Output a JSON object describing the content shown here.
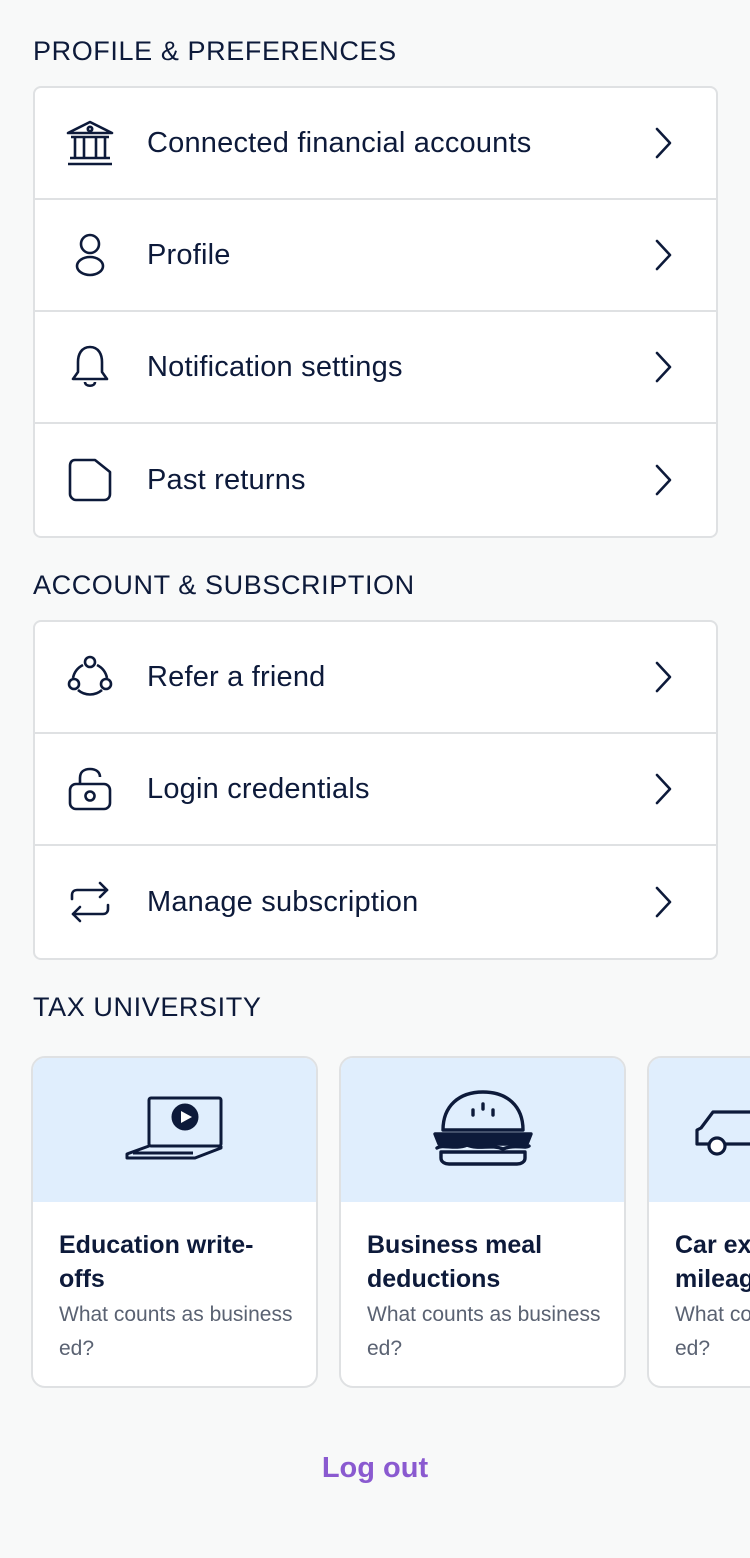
{
  "profile_section": {
    "title": "PROFILE & PREFERENCES",
    "items": [
      {
        "label": "Connected financial accounts",
        "icon": "bank-icon"
      },
      {
        "label": "Profile",
        "icon": "person-icon"
      },
      {
        "label": "Notification settings",
        "icon": "bell-icon"
      },
      {
        "label": "Past returns",
        "icon": "folder-icon"
      }
    ]
  },
  "account_section": {
    "title": "ACCOUNT & SUBSCRIPTION",
    "items": [
      {
        "label": "Refer a friend",
        "icon": "network-icon"
      },
      {
        "label": "Login credentials",
        "icon": "lock-icon"
      },
      {
        "label": "Manage subscription",
        "icon": "repeat-icon"
      }
    ]
  },
  "tax_university": {
    "title": "TAX UNIVERSITY",
    "cards": [
      {
        "title": "Education write-offs",
        "subtitle": "What counts as business ed?",
        "icon": "laptop-video-icon"
      },
      {
        "title": "Business meal deductions",
        "subtitle": "What counts as business ed?",
        "icon": "burger-icon"
      },
      {
        "title": "Car expenses & mileage",
        "subtitle": "What counts as business ed?",
        "icon": "car-icon"
      }
    ]
  },
  "logout_label": "Log out",
  "colors": {
    "text": "#0d1a3a",
    "border": "#dfe1e3",
    "banner": "#e0eefd",
    "accent": "#8a5ad0",
    "background": "#f8f9f9"
  }
}
